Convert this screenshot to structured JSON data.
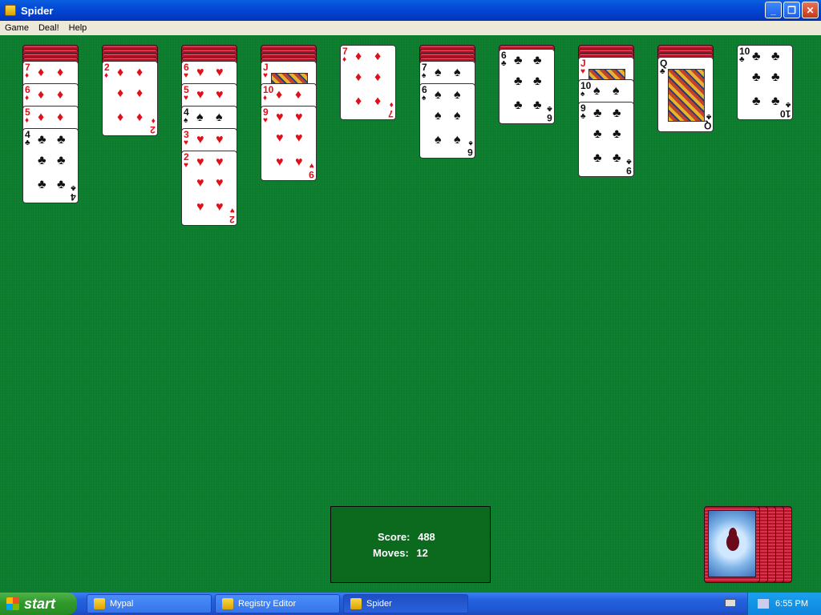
{
  "window": {
    "title": "Spider"
  },
  "menu": [
    "Game",
    "Deal!",
    "Help"
  ],
  "score": {
    "score_label": "Score:",
    "score_value": "488",
    "moves_label": "Moves:",
    "moves_value": "12"
  },
  "taskbar": {
    "start_label": "start",
    "items": [
      {
        "label": "Mypal",
        "icon": "mypal-icon"
      },
      {
        "label": "Registry Editor",
        "icon": "registry-icon"
      },
      {
        "label": "Spider",
        "icon": "spider-icon",
        "active": true
      }
    ],
    "clock": "6:55 PM"
  },
  "tableau": [
    {
      "backs": 4,
      "up": [
        {
          "r": "7",
          "s": "♦"
        },
        {
          "r": "6",
          "s": "♦"
        },
        {
          "r": "5",
          "s": "♦"
        },
        {
          "r": "4",
          "s": "♣"
        }
      ]
    },
    {
      "backs": 4,
      "up": [
        {
          "r": "2",
          "s": "♦"
        }
      ]
    },
    {
      "backs": 4,
      "up": [
        {
          "r": "6",
          "s": "♥"
        },
        {
          "r": "5",
          "s": "♥"
        },
        {
          "r": "4",
          "s": "♠"
        },
        {
          "r": "3",
          "s": "♥"
        },
        {
          "r": "2",
          "s": "♥"
        }
      ]
    },
    {
      "backs": 4,
      "up": [
        {
          "r": "J",
          "s": "♥"
        },
        {
          "r": "10",
          "s": "♦"
        },
        {
          "r": "9",
          "s": "♥"
        }
      ]
    },
    {
      "backs": 0,
      "up": [
        {
          "r": "7",
          "s": "♦"
        }
      ]
    },
    {
      "backs": 4,
      "up": [
        {
          "r": "7",
          "s": "♠"
        },
        {
          "r": "6",
          "s": "♠"
        }
      ]
    },
    {
      "backs": 1,
      "up": [
        {
          "r": "6",
          "s": "♣"
        }
      ]
    },
    {
      "backs": 3,
      "up": [
        {
          "r": "J",
          "s": "♥"
        },
        {
          "r": "10",
          "s": "♠"
        },
        {
          "r": "9",
          "s": "♣"
        }
      ]
    },
    {
      "backs": 3,
      "up": [
        {
          "r": "Q",
          "s": "♣"
        }
      ]
    },
    {
      "backs": 0,
      "up": [
        {
          "r": "10",
          "s": "♣"
        }
      ]
    }
  ],
  "stock_count": 5
}
